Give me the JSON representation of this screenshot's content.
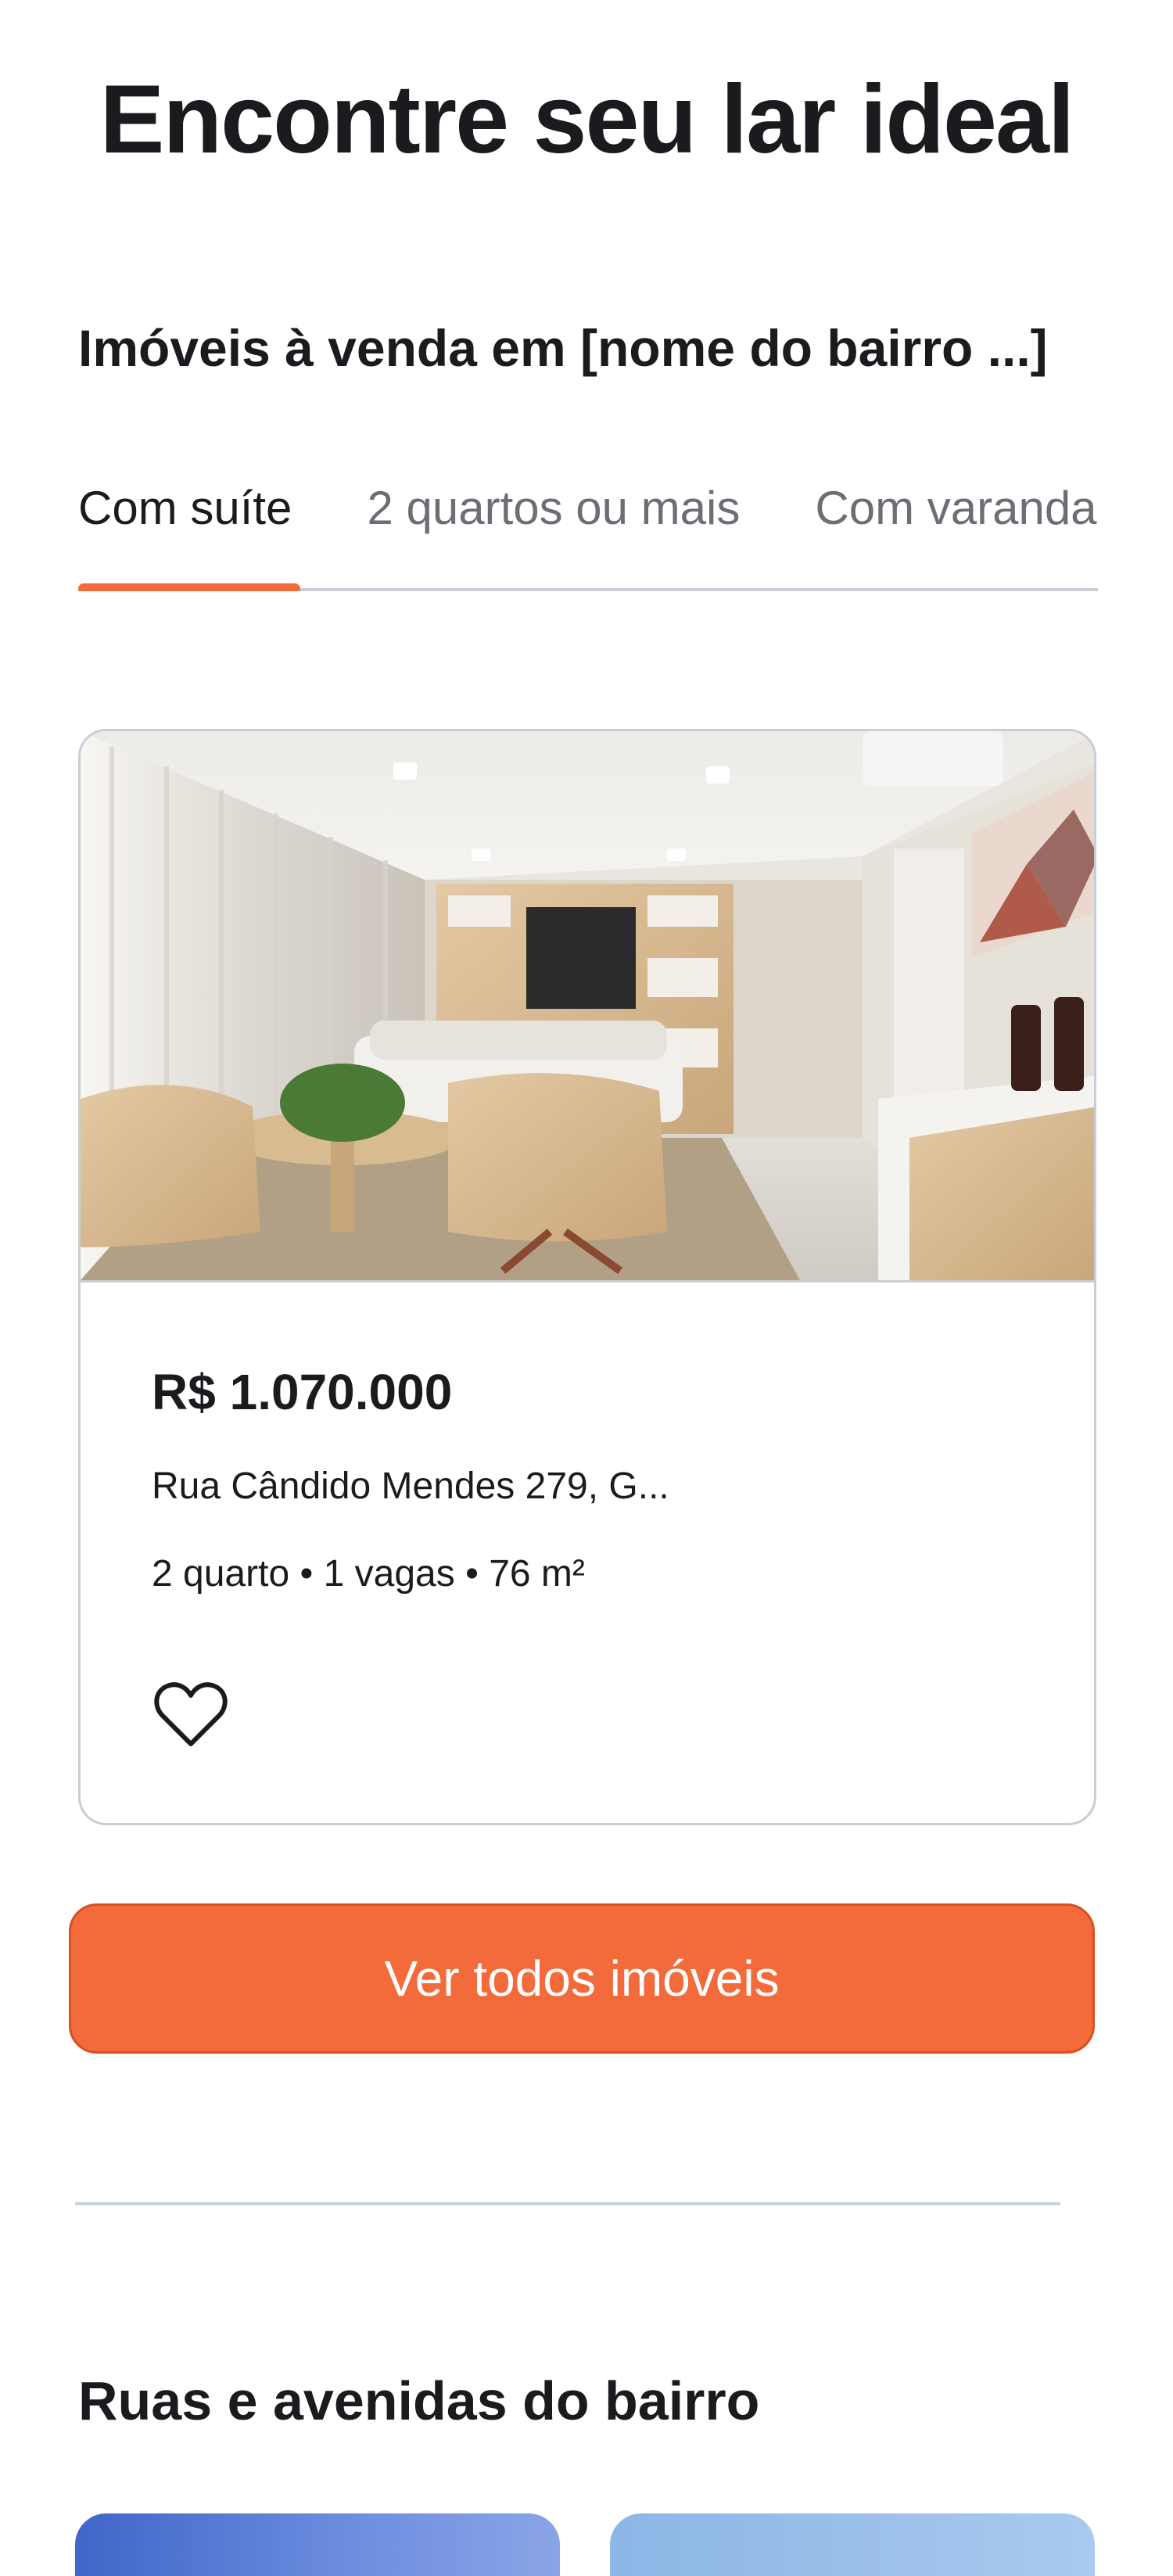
{
  "hero": {
    "title": "Encontre seu lar ideal"
  },
  "listings_section": {
    "title": "Imóveis à venda em [nome do bairro ...]",
    "tabs": [
      {
        "label": "Com suíte",
        "active": true
      },
      {
        "label": "2 quartos ou mais",
        "active": false
      },
      {
        "label": "Com varanda",
        "active": false
      }
    ]
  },
  "card": {
    "price": "R$ 1.070.000",
    "address": "Rua Cândido Mendes 279, G...",
    "features": "2 quarto • 1 vagas • 76 m²",
    "favorite_icon": "heart-outline-icon"
  },
  "cta": {
    "label": "Ver todos imóveis"
  },
  "streets_section": {
    "title": "Ruas e avenidas do bairro"
  },
  "colors": {
    "accent": "#f36b3b",
    "accent_border": "#d94f20",
    "text": "#1b1b1f",
    "muted_text": "#6b6e74",
    "border": "#c9ced6"
  }
}
